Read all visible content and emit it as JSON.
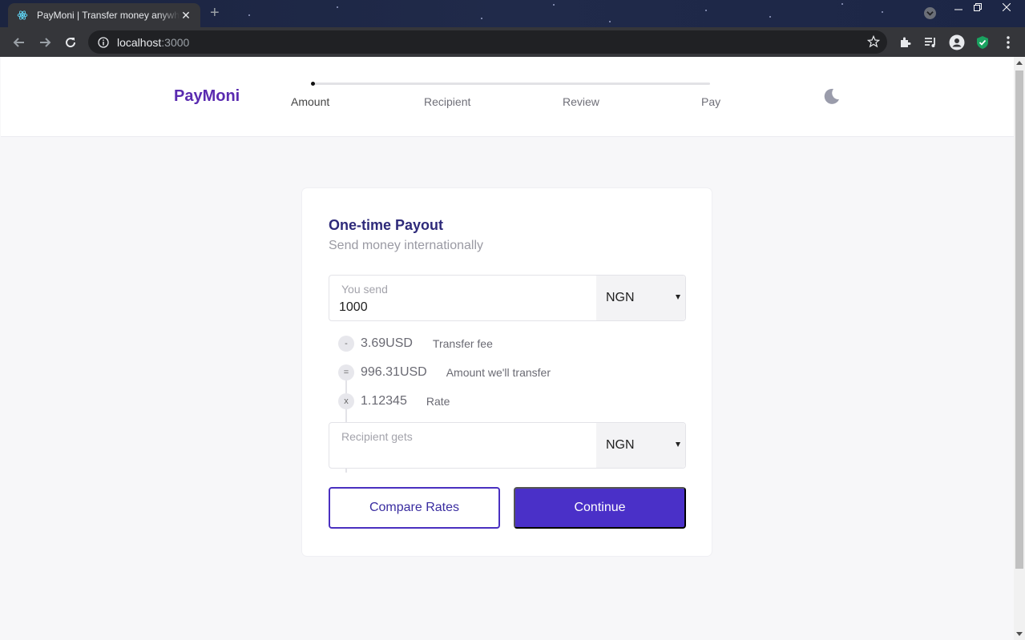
{
  "browser": {
    "tab_title": "PayMoni | Transfer money anywhere",
    "new_tab": "+",
    "close_tab": "✕",
    "url_host": "localhost",
    "url_port": ":3000"
  },
  "header": {
    "logo": "PayMoni",
    "steps": [
      "Amount",
      "Recipient",
      "Review",
      "Pay"
    ],
    "active_step": 0
  },
  "card": {
    "title": "One-time Payout",
    "subtitle": "Send money internationally",
    "send": {
      "label": "You send",
      "value": "1000",
      "currency": "NGN"
    },
    "breakdown": [
      {
        "op": "-",
        "amount": "3.69USD",
        "desc": "Transfer fee"
      },
      {
        "op": "=",
        "amount": "996.31USD",
        "desc": "Amount we'll transfer"
      },
      {
        "op": "x",
        "amount": "1.12345",
        "desc": "Rate"
      }
    ],
    "receive": {
      "label": "Recipient gets",
      "value": "",
      "currency": "NGN"
    },
    "compare_label": "Compare Rates",
    "continue_label": "Continue"
  },
  "colors": {
    "brand": "#5a2bb0",
    "primary": "#4a30c8",
    "title": "#2e2a7a"
  },
  "icons": [
    "react-icon",
    "close-icon",
    "plus-icon",
    "back-icon",
    "forward-icon",
    "reload-icon",
    "info-icon",
    "star-icon",
    "extensions-icon",
    "media-icon",
    "profile-icon",
    "shield-icon",
    "menu-icon",
    "moon-icon",
    "chevron-down-icon"
  ]
}
